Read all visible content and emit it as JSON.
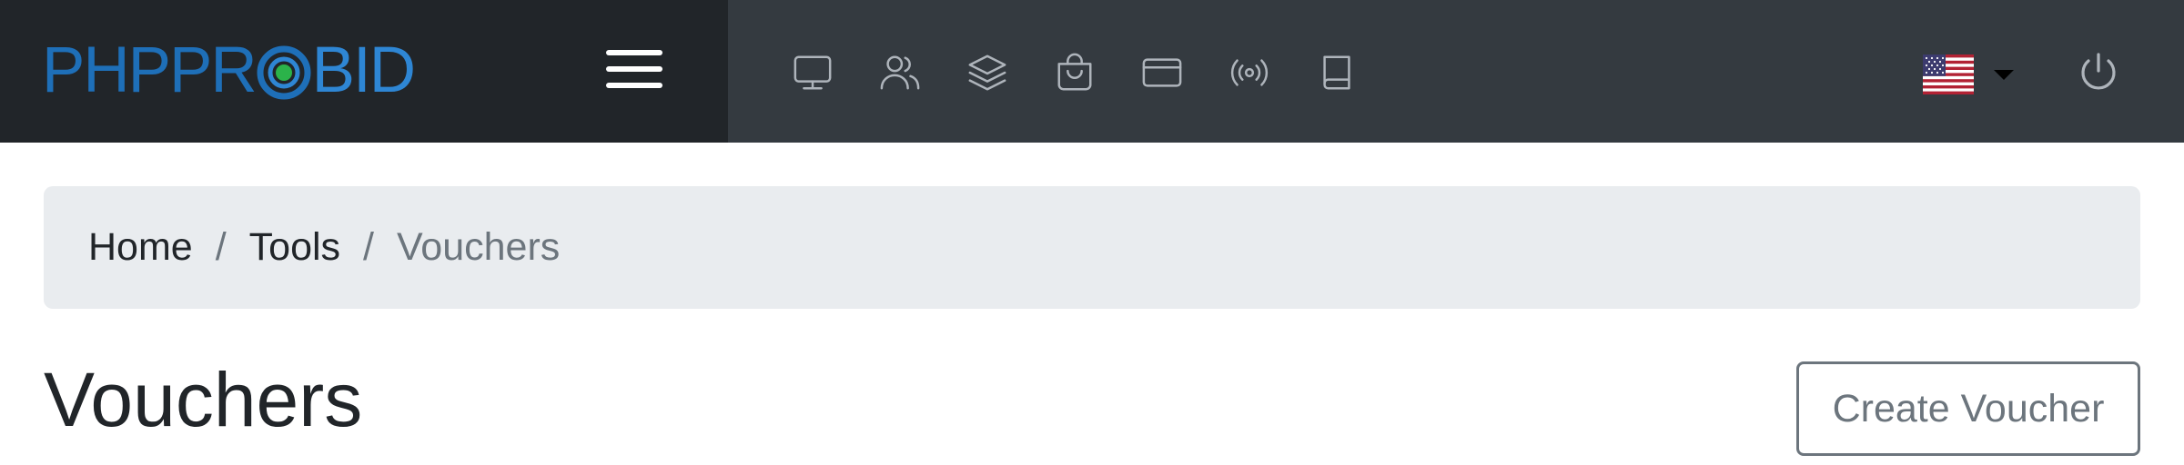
{
  "brand": {
    "logo_part1": "PHPPR",
    "logo_part2": "BID",
    "logo_colors": {
      "primary": "#1e6fb8",
      "secondary": "#2e86d4",
      "ring_accent": "#2bb34a"
    }
  },
  "topbar": {
    "menu_icon": "hamburger-icon",
    "nav_icons": [
      "monitor-icon",
      "users-icon",
      "layers-icon",
      "shopping-bag-icon",
      "credit-card-icon",
      "broadcast-icon",
      "book-icon"
    ],
    "language_flag": "us-flag-icon",
    "power_icon": "power-icon",
    "colors": {
      "bar": "#343a40",
      "brand_area": "#212529",
      "icon": "#aeb4bb"
    }
  },
  "breadcrumb": {
    "items": [
      "Home",
      "Tools"
    ],
    "active": "Vouchers",
    "separator": "/"
  },
  "page": {
    "title": "Vouchers",
    "create_button": "Create Voucher"
  }
}
